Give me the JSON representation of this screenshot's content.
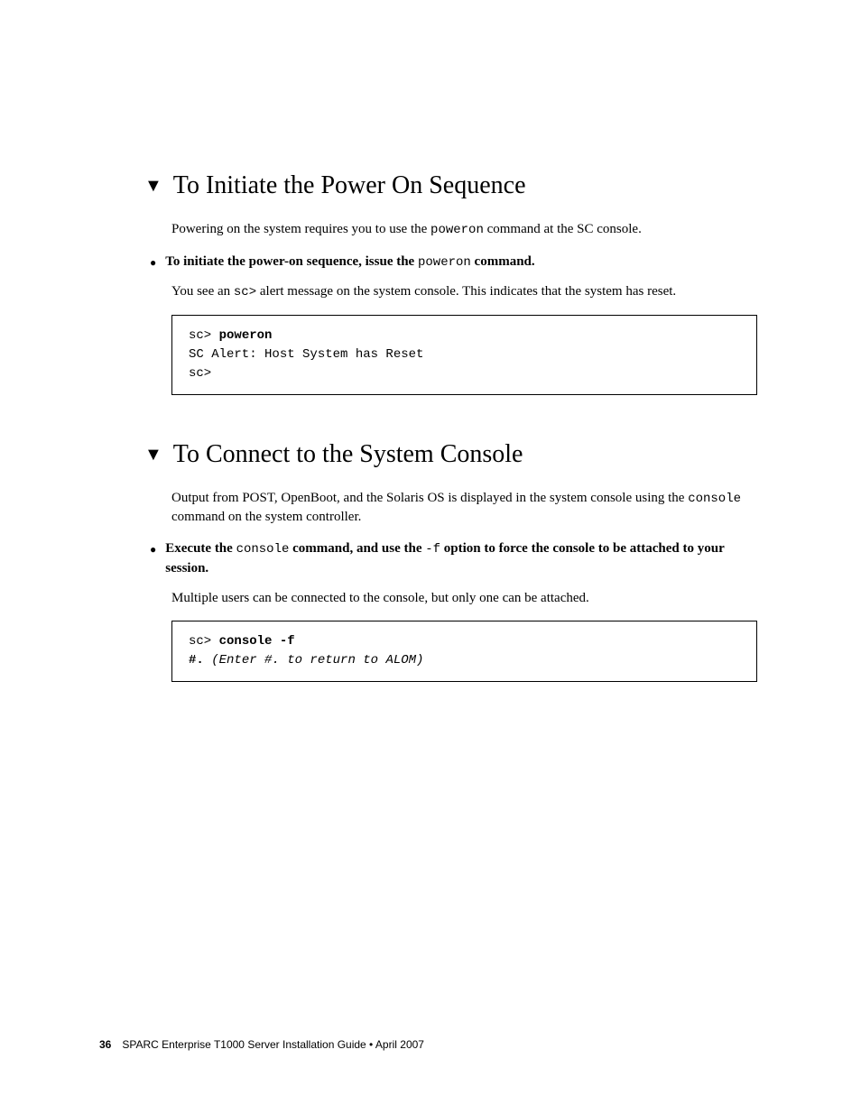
{
  "section1": {
    "heading": "To Initiate the Power On Sequence",
    "para1_a": "Powering on the system requires you to use the ",
    "para1_code": "poweron",
    "para1_b": " command at the SC console.",
    "bullet1_a": "To initiate the power-on sequence, issue the ",
    "bullet1_code": "poweron",
    "bullet1_b": " command.",
    "para2_a": "You see an ",
    "para2_code": "sc>",
    "para2_b": " alert message on the system console. This indicates that the system has reset.",
    "code_line1_prefix": "sc> ",
    "code_line1_bold": "poweron",
    "code_line2": "SC Alert: Host System has Reset",
    "code_line3": "sc>"
  },
  "section2": {
    "heading": "To Connect to the System Console",
    "para1_a": "Output from POST, OpenBoot, and the Solaris OS is displayed in the system console using the ",
    "para1_code": "console",
    "para1_b": " command on the system controller.",
    "bullet1_a": "Execute the ",
    "bullet1_code1": "console",
    "bullet1_b": " command, and use the ",
    "bullet1_code2": "-f",
    "bullet1_c": " option to force the console to be attached to your session.",
    "para2": "Multiple users can be connected to the console, but only one can be attached.",
    "code_line1_prefix": "sc> ",
    "code_line1_bold": "console -f",
    "code_line2_bold": "#.",
    "code_line2_italic": " (Enter #. to return to ALOM)"
  },
  "footer": {
    "pagenum": "36",
    "text": "SPARC Enterprise T1000 Server Installation Guide • April 2007"
  }
}
